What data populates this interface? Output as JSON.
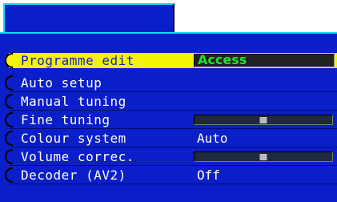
{
  "menu": {
    "items": [
      {
        "label": "Programme edit",
        "value": "Access",
        "kind": "access",
        "active": true
      },
      {
        "label": "Auto setup",
        "value": "",
        "kind": "none"
      },
      {
        "label": "Manual tuning",
        "value": "",
        "kind": "none"
      },
      {
        "label": "Fine tuning",
        "value": "",
        "kind": "slider",
        "level": 0.5
      },
      {
        "label": "Colour system",
        "value": "Auto",
        "kind": "text"
      },
      {
        "label": "Volume correc.",
        "value": "",
        "kind": "slider",
        "level": 0.5
      },
      {
        "label": "Decoder (AV2)",
        "value": "Off",
        "kind": "text"
      }
    ]
  },
  "colors": {
    "panel": "#0a1fc9",
    "highlight": "#f5f400",
    "access": "#22e12b",
    "border": "#18d8ff"
  }
}
